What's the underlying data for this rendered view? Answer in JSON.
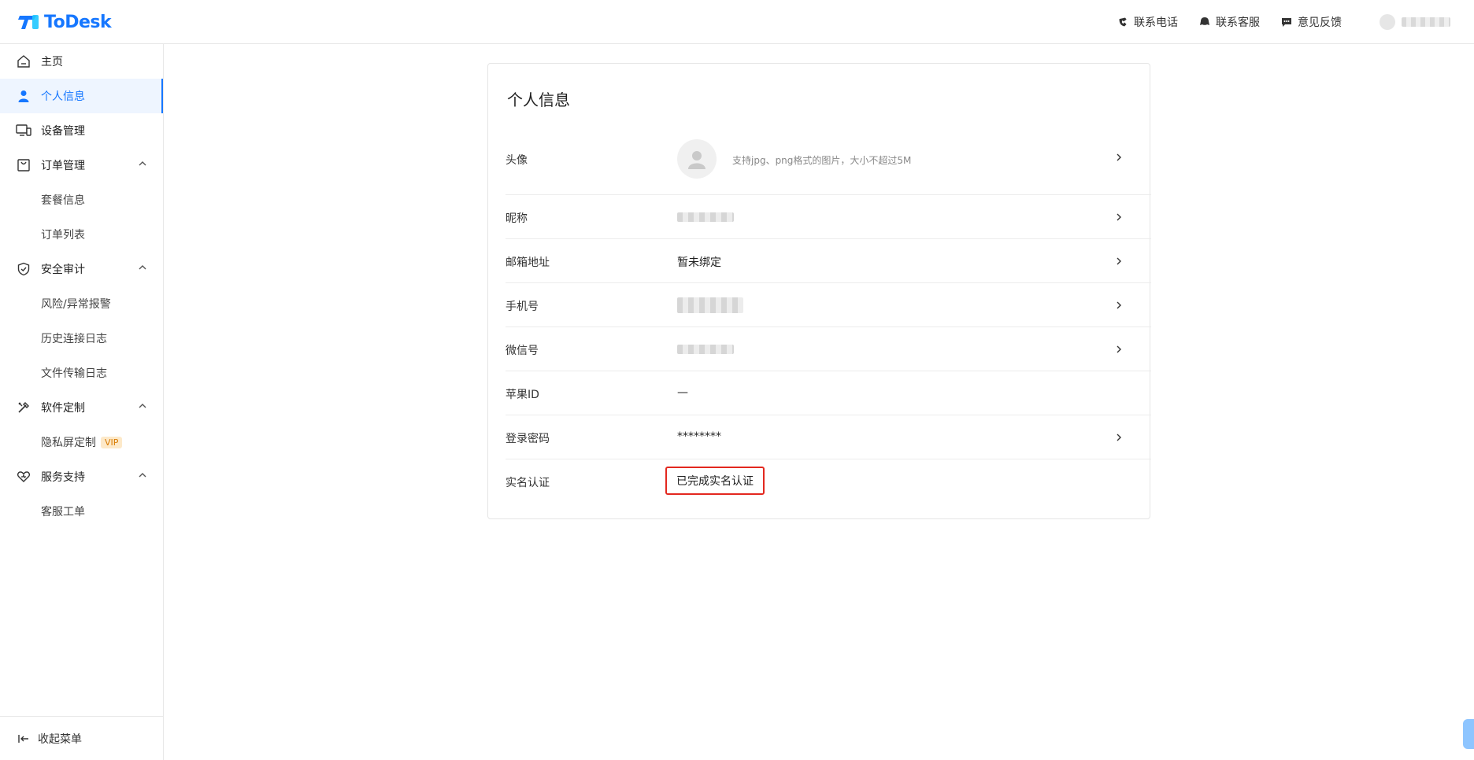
{
  "header": {
    "logo_text": "ToDesk",
    "links": [
      {
        "label": "联系电话",
        "icon": "phone-icon"
      },
      {
        "label": "联系客服",
        "icon": "chat-bubble-icon"
      },
      {
        "label": "意见反馈",
        "icon": "feedback-icon"
      }
    ]
  },
  "sidebar": {
    "items": [
      {
        "label": "主页",
        "icon": "home-icon"
      },
      {
        "label": "个人信息",
        "icon": "user-icon",
        "active": true
      },
      {
        "label": "设备管理",
        "icon": "devices-icon"
      },
      {
        "label": "订单管理",
        "icon": "bag-icon",
        "children": [
          "套餐信息",
          "订单列表"
        ]
      },
      {
        "label": "安全审计",
        "icon": "shield-icon",
        "children": [
          "风险/异常报警",
          "历史连接日志",
          "文件传输日志"
        ]
      },
      {
        "label": "软件定制",
        "icon": "tools-icon",
        "children": [
          "隐私屏定制"
        ]
      },
      {
        "label": "服务支持",
        "icon": "heart-icon",
        "children": [
          "客服工单"
        ]
      }
    ],
    "vip_badge": "VIP",
    "collapse_label": "收起菜单"
  },
  "profile": {
    "title": "个人信息",
    "avatar": {
      "label": "头像",
      "hint": "支持jpg、png格式的图片，大小不超过5M"
    },
    "nickname": {
      "label": "昵称"
    },
    "email": {
      "label": "邮箱地址",
      "value": "暂未绑定"
    },
    "phone": {
      "label": "手机号"
    },
    "wechat": {
      "label": "微信号"
    },
    "apple_id": {
      "label": "苹果ID",
      "value": "—"
    },
    "password": {
      "label": "登录密码",
      "value": "********"
    },
    "real_name": {
      "label": "实名认证",
      "value": "已完成实名认证"
    }
  },
  "colors": {
    "accent": "#1677ff",
    "highlight_border": "#e3281f"
  }
}
